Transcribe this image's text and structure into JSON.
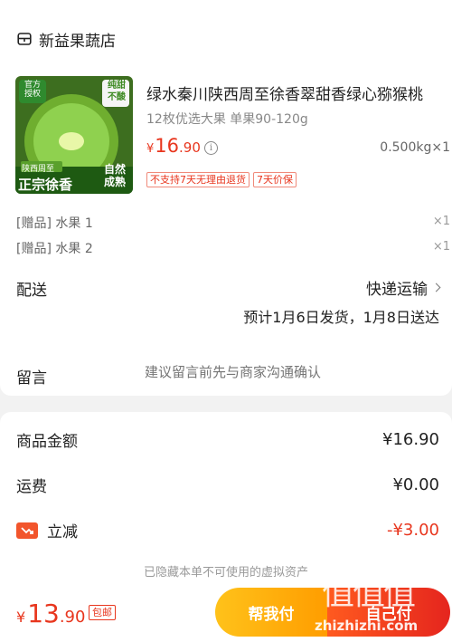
{
  "shop": {
    "name": "新益果蔬店",
    "icon": "store-icon"
  },
  "product": {
    "title": "绿水秦川陕西周至徐香翠甜香绿心猕猴桃",
    "spec": "12枚优选大果 单果90-120g",
    "price_currency": "¥",
    "price_int": "16",
    "price_dec": ".90",
    "info_icon": "info-icon",
    "qty": "0.500kg×1",
    "tags": [
      "不支持7天无理由退货",
      "7天价保"
    ],
    "image": {
      "badge_tl": "官方\n授权",
      "badge_tr": "纯甜\n不酸",
      "origin": "陕西周至",
      "brand": "正宗徐香",
      "natural": "自然\n成熟",
      "colors": {
        "bg": "#3d6e1f",
        "fruit": "#8fd14f",
        "core": "#e8f7a8"
      }
    }
  },
  "gifts": [
    {
      "label": "[赠品] 水果 1",
      "qty": "×1"
    },
    {
      "label": "[赠品] 水果 2",
      "qty": "×1"
    }
  ],
  "delivery": {
    "label": "配送",
    "method": "快递运输",
    "eta": "预计1月6日发货，1月8日送达"
  },
  "remark": {
    "label": "留言",
    "placeholder": "建议留言前先与商家沟通确认"
  },
  "summary": {
    "goods_label": "商品金额",
    "goods_value": "¥16.90",
    "freight_label": "运费",
    "freight_value": "¥0.00",
    "discount_label": "立减",
    "discount_value": "-¥3.00",
    "hidden_note": "已隐藏本单不可使用的虚拟资产"
  },
  "footer": {
    "total_currency": "¥",
    "total_int": "13",
    "total_dec": ".90",
    "free_ship": "包邮",
    "help_pay": "帮我付",
    "pay": "自己付",
    "watermark": "值值值",
    "watermark_site": "zhizhizhi.com"
  },
  "colors": {
    "accent": "#e8361e",
    "help_btn": "#ffb300",
    "pay_btn": "#f03c1e"
  }
}
